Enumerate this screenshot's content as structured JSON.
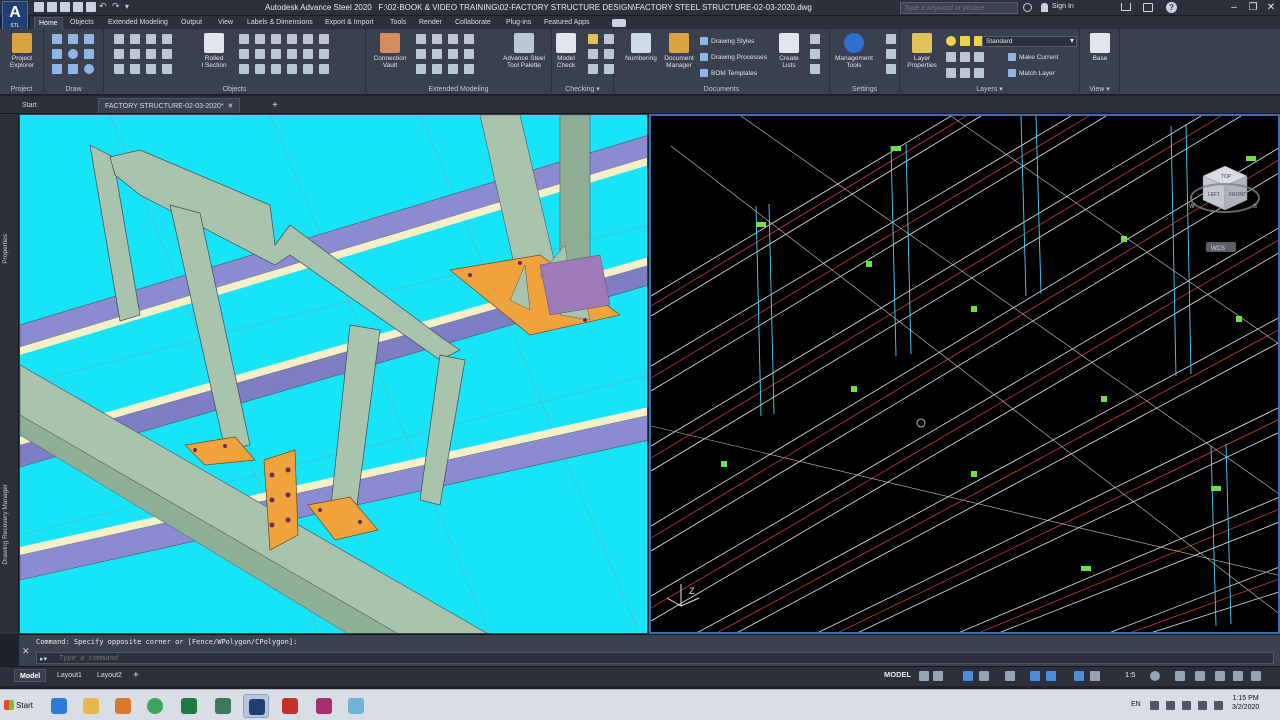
{
  "app": {
    "logo": "A",
    "logo_sub": "STL",
    "title": "Autodesk Advance Steel 2020",
    "file_path": "F:\\02-BOOK & VIDEO TRAINING\\02-FACTORY STRUCTURE DESIGN\\FACTORY STEEL STRUCTURE-02-03-2020.dwg"
  },
  "search": {
    "placeholder": "Type a keyword or phrase"
  },
  "account": {
    "sign_in": "Sign In"
  },
  "ribbon_tabs": [
    "Home",
    "Objects",
    "Extended Modeling",
    "Output",
    "View",
    "Labels & Dimensions",
    "Export & Import",
    "Tools",
    "Render",
    "Collaborate",
    "Plug-ins",
    "Featured Apps"
  ],
  "panels": {
    "project": {
      "title": "Project",
      "btn": "Project\nExplorer"
    },
    "draw": {
      "title": "Draw"
    },
    "objects": {
      "title": "Objects",
      "rolled": "Rolled\nI Section"
    },
    "extended": {
      "title": "Extended Modeling",
      "connection_vault": "Connection\nVault",
      "tool_palette": "Advance Steel\nTool Palette"
    },
    "checking": {
      "title": "Checking",
      "model_check": "Model\nCheck"
    },
    "documents": {
      "title": "Documents",
      "numbering": "Numbering",
      "doc_manager": "Document\nManager",
      "drawing_styles": "Drawing Styles",
      "drawing_processes": "Drawing Processes",
      "bom_templates": "BOM Templates",
      "create_lists": "Create\nLists"
    },
    "settings": {
      "title": "Settings",
      "mgmt_tools": "Management\nTools"
    },
    "layers": {
      "title": "Layers",
      "layer_props": "Layer\nProperties",
      "layer_current": "Standard",
      "make_current": "Make Current",
      "match_layer": "Match Layer"
    },
    "view": {
      "title": "View",
      "base": "Base"
    }
  },
  "doc_tabs": [
    "Start",
    "FACTORY STRUCTURE-02-03-2020*"
  ],
  "side_labels": {
    "properties": "Properties",
    "recovery": "Drawing Recovery Manager"
  },
  "viewcube": {
    "top": "TOP",
    "left": "LEFT",
    "front": "FRONT",
    "w": "W",
    "s": "S",
    "wcs": "WCS"
  },
  "ucs": {
    "z": "Z"
  },
  "command": {
    "history": "Command: Specify opposite corner or [Fence/WPolygon/CPolygon]:",
    "placeholder": "Type a command"
  },
  "layout_tabs": [
    "Model",
    "Layout1",
    "Layout2"
  ],
  "status": {
    "model": "MODEL",
    "scale": "1:5"
  },
  "taskbar": {
    "start": "Start",
    "lang": "EN",
    "time": "1:15 PM",
    "date": "3/2/2020"
  },
  "colors": {
    "model_bg": "#18e4f8",
    "wire_bg": "#000000",
    "member": "#a8c4ad",
    "beam": "#7d7ec4",
    "plate": "#f0a23c",
    "accent": "#3f6fb0"
  }
}
